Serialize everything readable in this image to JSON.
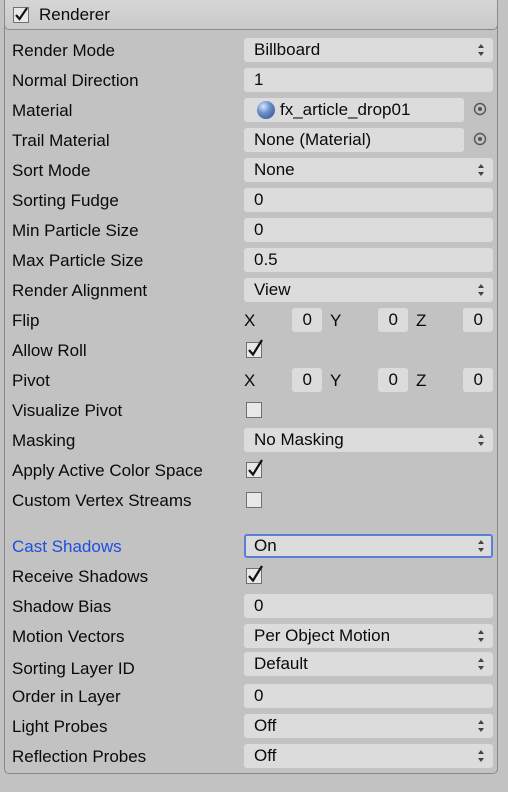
{
  "header": {
    "title": "Renderer",
    "enabled": true
  },
  "rows": {
    "render_mode": {
      "label": "Render Mode",
      "value": "Billboard"
    },
    "normal_direction": {
      "label": "Normal Direction",
      "value": "1"
    },
    "material": {
      "label": "Material",
      "value": "fx_article_drop01"
    },
    "trail_material": {
      "label": "Trail Material",
      "value": "None (Material)"
    },
    "sort_mode": {
      "label": "Sort Mode",
      "value": "None"
    },
    "sorting_fudge": {
      "label": "Sorting Fudge",
      "value": "0"
    },
    "min_particle_size": {
      "label": "Min Particle Size",
      "value": "0"
    },
    "max_particle_size": {
      "label": "Max Particle Size",
      "value": "0.5"
    },
    "render_alignment": {
      "label": "Render Alignment",
      "value": "View"
    },
    "flip": {
      "label": "Flip",
      "x_label": "X",
      "x": "0",
      "y_label": "Y",
      "y": "0",
      "z_label": "Z",
      "z": "0"
    },
    "allow_roll": {
      "label": "Allow Roll",
      "checked": true
    },
    "pivot": {
      "label": "Pivot",
      "x_label": "X",
      "x": "0",
      "y_label": "Y",
      "y": "0",
      "z_label": "Z",
      "z": "0"
    },
    "visualize_pivot": {
      "label": "Visualize Pivot",
      "checked": false
    },
    "masking": {
      "label": "Masking",
      "value": "No Masking"
    },
    "apply_active_color_space": {
      "label": "Apply Active Color Space",
      "checked": true
    },
    "custom_vertex_streams": {
      "label": "Custom Vertex Streams",
      "checked": false
    },
    "cast_shadows": {
      "label": "Cast Shadows",
      "value": "On"
    },
    "receive_shadows": {
      "label": "Receive Shadows",
      "checked": true
    },
    "shadow_bias": {
      "label": "Shadow Bias",
      "value": "0"
    },
    "motion_vectors": {
      "label": "Motion Vectors",
      "value": "Per Object Motion"
    },
    "sorting_layer_id": {
      "label": "Sorting Layer ID",
      "value": "Default"
    },
    "order_in_layer": {
      "label": "Order in Layer",
      "value": "0"
    },
    "light_probes": {
      "label": "Light Probes",
      "value": "Off"
    },
    "reflection_probes": {
      "label": "Reflection Probes",
      "value": "Off"
    }
  },
  "colors": {
    "panel_bg": "#c2c2c2",
    "field_bg": "#dcdcdc",
    "focus_label": "#1e4fe0",
    "focus_border": "#5b7fd6"
  },
  "icons": {
    "dropdown": "updown-arrows-icon",
    "picker": "object-picker-icon",
    "check": "checkmark-icon",
    "material": "material-sphere-icon"
  }
}
